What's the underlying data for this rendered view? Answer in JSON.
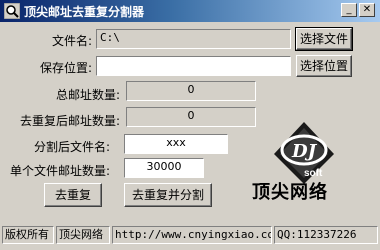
{
  "window": {
    "title": "顶尖邮址去重复分割器",
    "icons": {
      "app": "magnifier-icon",
      "minimize": "minimize-icon",
      "close": "close-icon"
    }
  },
  "form": {
    "filename_label": "文件名:",
    "filename_value": "C:\\",
    "browse_file_button": "选择文件",
    "save_label": "保存位置:",
    "save_value": "",
    "browse_save_button": "选择位置",
    "total_label": "总邮址数量:",
    "total_value": "0",
    "dedup_label": "去重复后邮址数量:",
    "dedup_value": "0",
    "split_name_label": "分割后文件名:",
    "split_name_value": "xxx",
    "per_file_label": "单个文件邮址数量:",
    "per_file_value": "30000",
    "dedup_button": "去重复",
    "dedup_split_button": "去重复并分割"
  },
  "logo": {
    "mark": "DJ",
    "sub": "soft",
    "brand": "顶尖网络"
  },
  "statusbar": {
    "copyright": "版权所有",
    "company": "顶尖网络",
    "url": "http://www.cnyingxiao.com",
    "qq": "QQ:112337226"
  }
}
